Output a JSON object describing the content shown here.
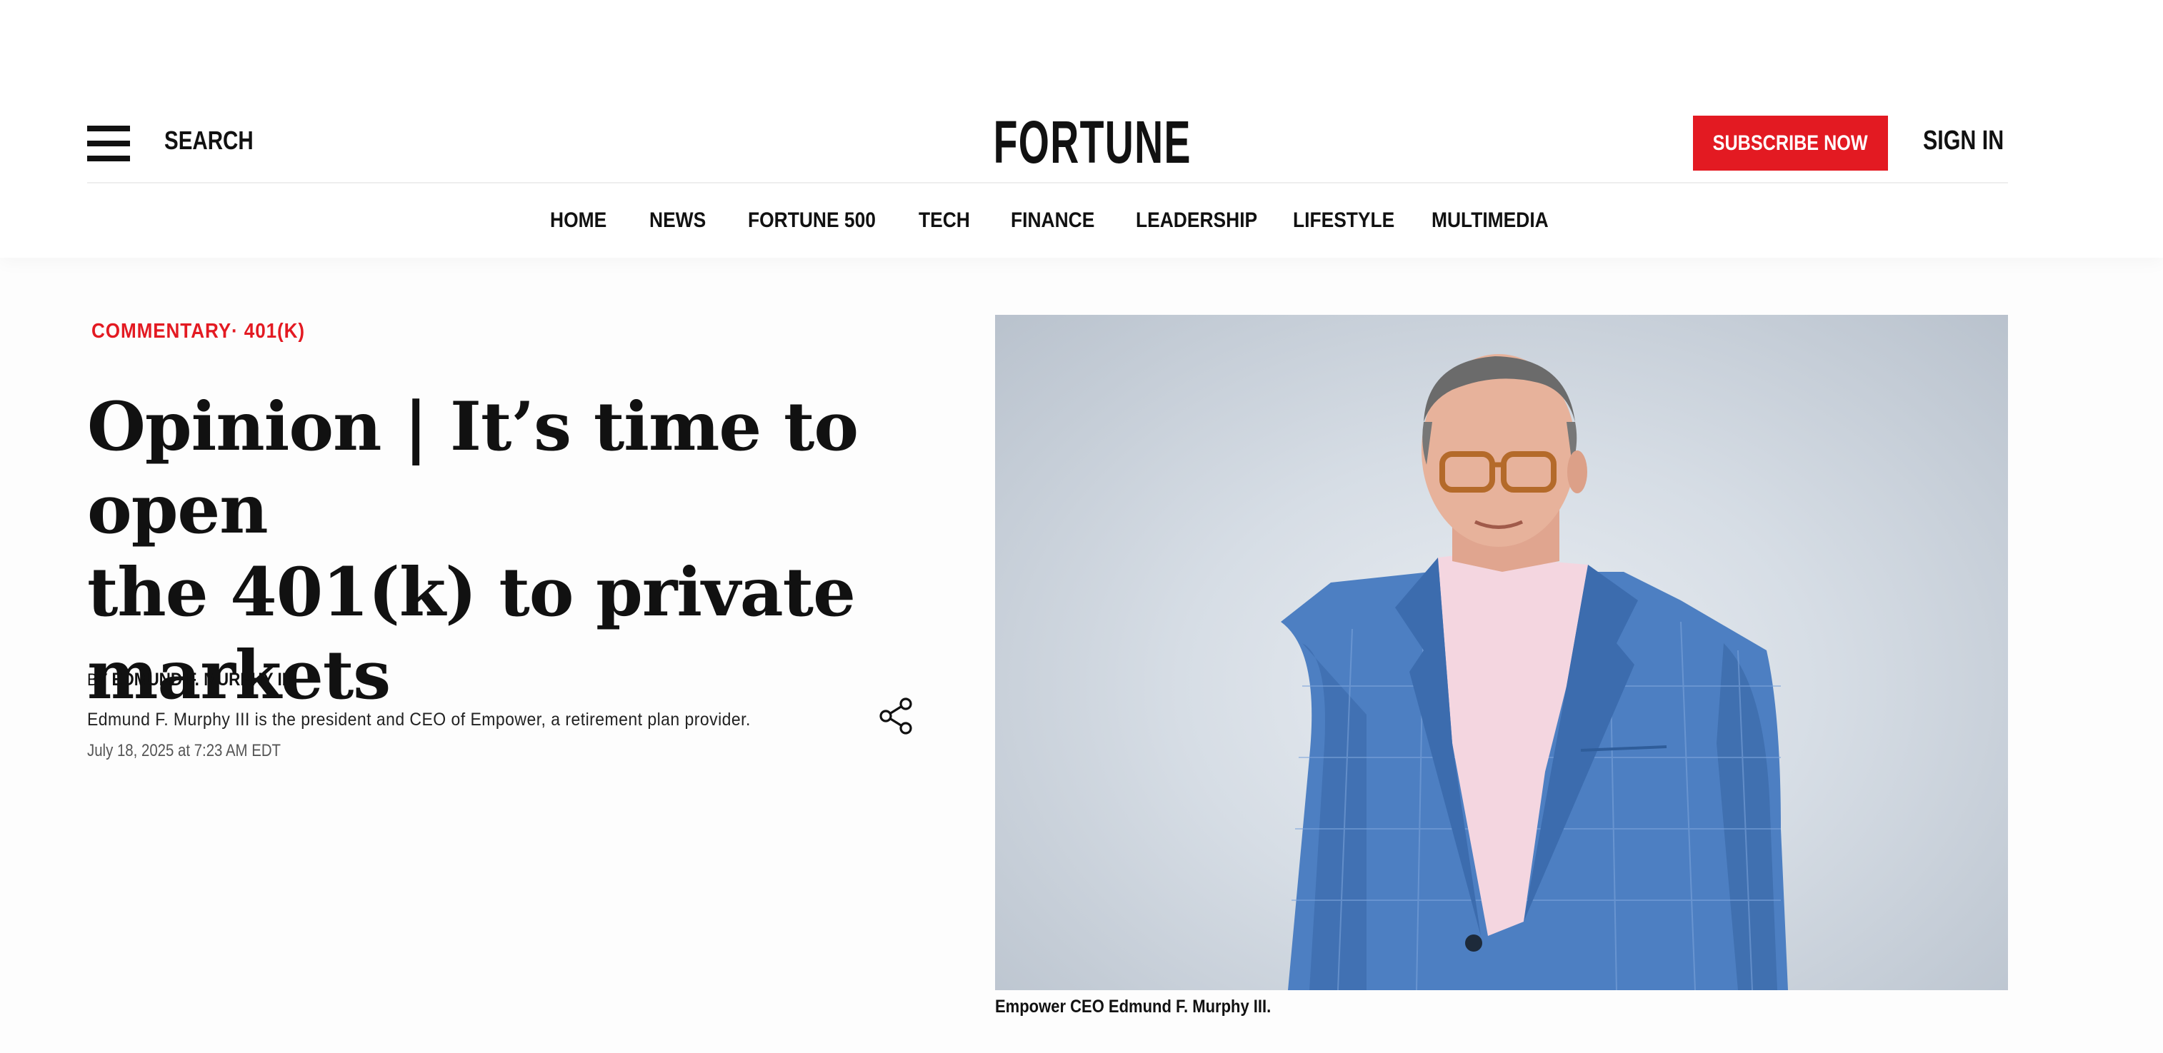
{
  "header": {
    "search_label": "SEARCH",
    "logo": "FORTUNE",
    "subscribe_label": "SUBSCRIBE NOW",
    "signin_label": "SIGN IN",
    "brand_color": "#e31a22"
  },
  "nav": {
    "items": [
      "HOME",
      "NEWS",
      "FORTUNE 500",
      "TECH",
      "FINANCE",
      "LEADERSHIP",
      "LIFESTYLE",
      "MULTIMEDIA"
    ]
  },
  "article": {
    "category_primary": "COMMENTARY",
    "category_separator": "·",
    "category_secondary": "401(K)",
    "headline_line1": "Opinion | It’s time to open",
    "headline_line2": "the 401(k) to private",
    "headline_line3": "markets",
    "byline_prefix": "BY",
    "author": "EDMUND F. MURPHY III",
    "bio": "Edmund F. Murphy III is the president and CEO of Empower, a retirement plan provider.",
    "date": "July 18, 2025 at 7:23 AM EDT",
    "image_caption": "Empower CEO Edmund F. Murphy III."
  },
  "icons": {
    "menu": "hamburger-menu-icon",
    "share": "share-icon"
  }
}
